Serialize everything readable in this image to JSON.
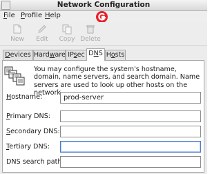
{
  "window": {
    "title": "Network Configuration"
  },
  "menubar": {
    "file": {
      "mnemonic": "F",
      "rest": "ile"
    },
    "profile": {
      "mnemonic": "P",
      "rest": "rofile"
    },
    "help": {
      "mnemonic": "H",
      "rest": "elp"
    }
  },
  "toolbar": {
    "new_label": "New",
    "edit_label": "Edit",
    "copy_label": "Copy",
    "delete_label": "Delete"
  },
  "tabs": [
    {
      "pre": "",
      "mnemonic": "D",
      "post": "evices"
    },
    {
      "pre": "Hard",
      "mnemonic": "w",
      "post": "are"
    },
    {
      "pre": "IP",
      "mnemonic": "s",
      "post": "ec"
    },
    {
      "pre": "D",
      "mnemonic": "N",
      "post": "S"
    },
    {
      "pre": "H",
      "mnemonic": "o",
      "post": "sts"
    }
  ],
  "active_tab": "DNS",
  "dns": {
    "description": "You may configure the system's hostname, domain, name servers, and search domain. Name servers are used to look up other hosts on the network.",
    "hostname": {
      "mnemonic": "H",
      "rest": "ostname:",
      "value": "prod-server"
    },
    "primary_dns": {
      "mnemonic": "P",
      "rest": "rimary DNS:",
      "value": ""
    },
    "secondary_dns": {
      "mnemonic": "S",
      "rest": "econdary DNS:",
      "value": ""
    },
    "tertiary_dns": {
      "mnemonic": "T",
      "rest": "ertiary DNS:",
      "value": ""
    },
    "search_path": {
      "label": "DNS search path:",
      "value": ""
    }
  },
  "colors": {
    "logo_red": "#e8202a",
    "accent": "#4a7ec9"
  }
}
